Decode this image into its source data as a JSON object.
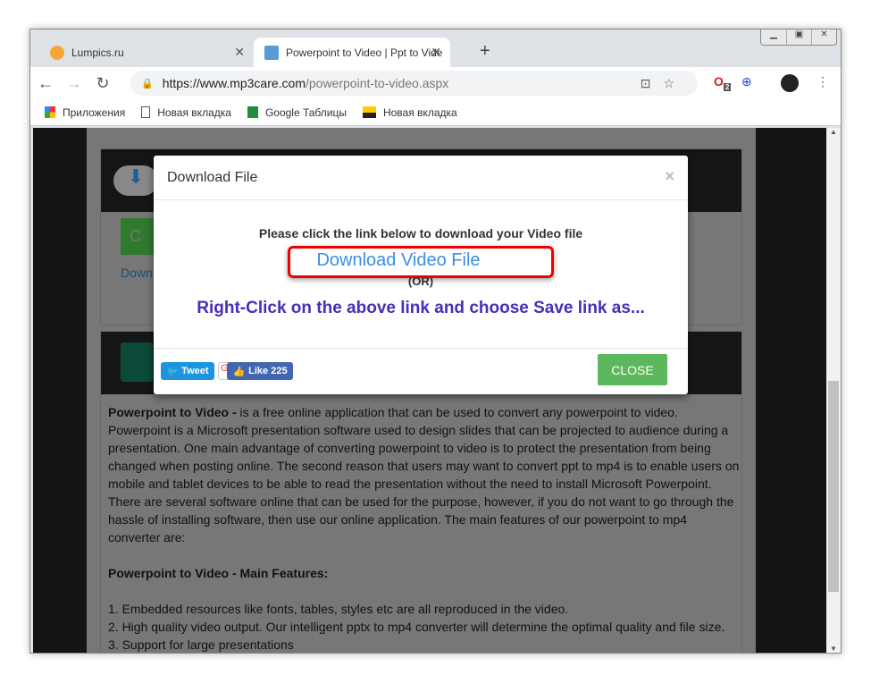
{
  "browser": {
    "tabs": [
      {
        "label": "Lumpics.ru"
      },
      {
        "label": "Powerpoint to Video | Ppt to Vide"
      }
    ],
    "url_host": "https://www.mp3care.com",
    "url_path": "/powerpoint-to-video.aspx",
    "ext_badge": "2",
    "bookmarks": [
      {
        "label": "Приложения",
        "icon": "apps-grid-icon"
      },
      {
        "label": "Новая вкладка",
        "icon": "page-icon"
      },
      {
        "label": "Google Таблицы",
        "icon": "sheets-icon"
      },
      {
        "label": "Новая вкладка",
        "icon": "image-icon"
      }
    ]
  },
  "page": {
    "bg_button_label": "C",
    "bg_link": "Down",
    "intro_bold": "Powerpoint to Video -",
    "intro": " is a free online application that can be used to convert any powerpoint to video. Powerpoint is a Microsoft presentation software used to design slides that can be projected to audience during a presentation. One main advantage of converting powerpoint to video is to protect the presentation from being changed when posting online. The second reason that users may want to convert ppt to mp4 is to enable users on mobile and tablet devices to be able to read the presentation without the need to install Microsoft Powerpoint. There are several software online that can be used for the purpose, however, if you do not want to go through the hassle of installing software, then use our online application. The main features of our powerpoint to mp4 converter are:",
    "features_title": "Powerpoint to Video - Main Features:",
    "features": [
      "1. Embedded resources like fonts, tables, styles etc are all reproduced in the video.",
      "2. High quality video output. Our intelligent pptx to mp4 converter will determine the optimal quality and file size.",
      "3. Support for large presentations"
    ]
  },
  "modal": {
    "title": "Download File",
    "close_x": "×",
    "message": "Please click the link below to download your Video file",
    "link": "Download Video File",
    "or": "(OR)",
    "hint": "Right-Click on the above link and choose Save link as...",
    "tweet": "Tweet",
    "like": "Like 225",
    "close": "CLOSE"
  },
  "colors": {
    "accent_link": "#3a8ee6",
    "highlight": "#e00000",
    "close_button": "#5cb85c",
    "hint": "#4a2db8"
  }
}
